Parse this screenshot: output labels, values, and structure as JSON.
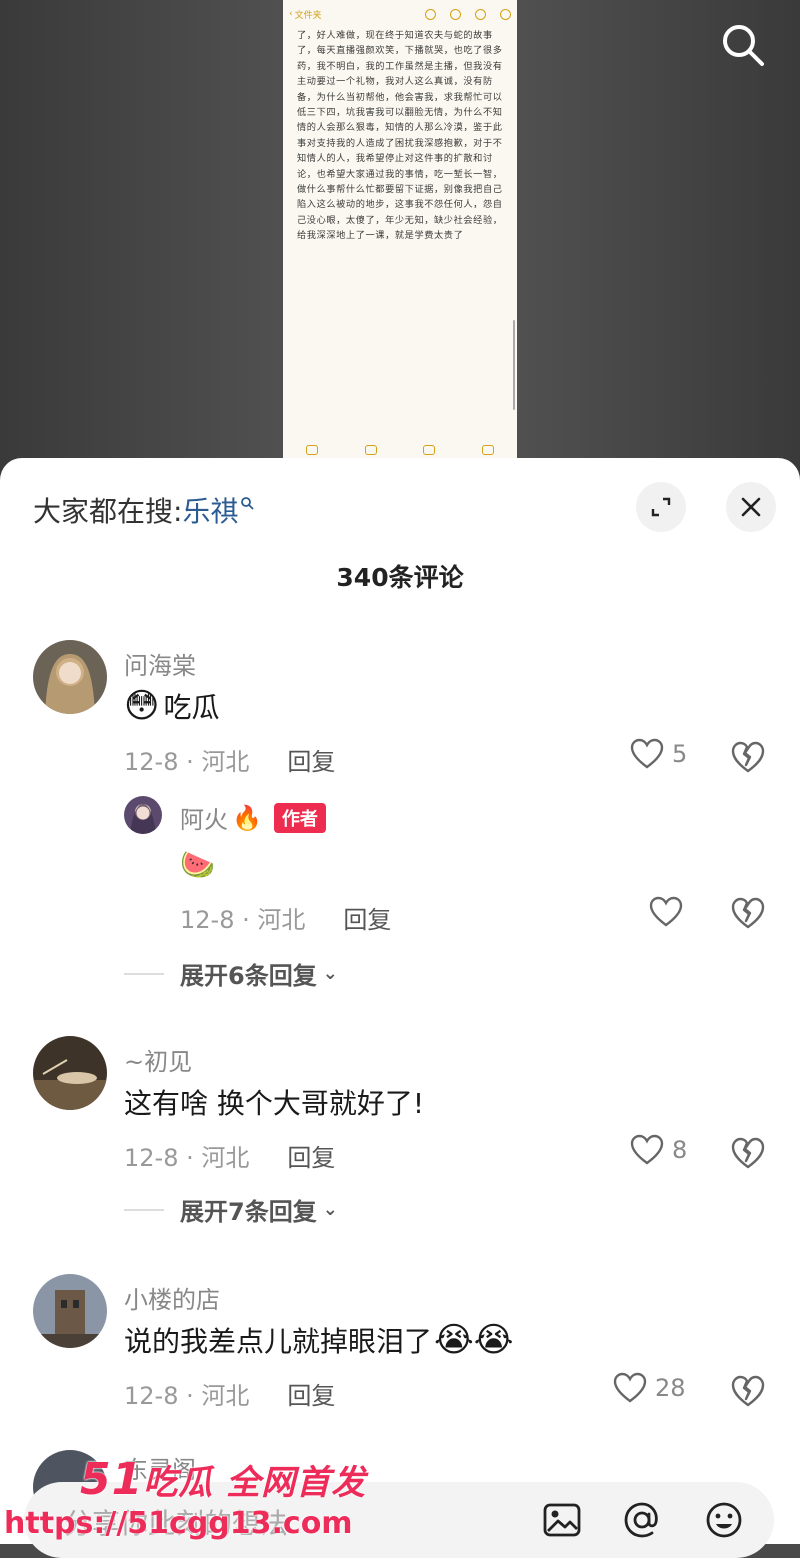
{
  "video": {
    "note_back_label": "文件夹",
    "note_text": "了，好人难做，现在终于知道农夫与蛇的故事了，每天直播强颜欢笑，下播就哭，也吃了很多药，我不明白，我的工作虽然是主播，但我没有主动要过一个礼物，我对人这么真诚，没有防备，为什么当初帮他，他会害我，求我帮忙可以低三下四，坑我害我可以翻脸无情，为什么不知情的人会那么狠毒，知情的人那么冷漠，鉴于此事对支持我的人造成了困扰我深感抱歉，对于不知情人的人，我希望停止对这件事的扩散和讨论，也希望大家通过我的事情，吃一堑长一智，做什么事帮什么忙都要留下证据，别像我把自己陷入这么被动的地步，这事我不怨任何人，怨自己没心眼，太傻了，年少无知，缺少社会经验，给我深深地上了一课，就是学费太贵了"
  },
  "sheet": {
    "trending_prefix": "大家都在搜:",
    "trending_term": "乐祺",
    "comment_count_label": "340条评论"
  },
  "comments": [
    {
      "username": "问海棠",
      "text": "吃瓜",
      "date_location": "12-8 · 河北",
      "reply_label": "回复",
      "likes": "5",
      "replies": [
        {
          "username": "阿火",
          "badge": "作者",
          "text": "🍉",
          "date_location": "12-8 · 河北",
          "reply_label": "回复"
        }
      ],
      "expand_label": "展开6条回复"
    },
    {
      "username": "~初见",
      "text": "这有啥 换个大哥就好了!",
      "date_location": "12-8 · 河北",
      "reply_label": "回复",
      "likes": "8",
      "expand_label": "展开7条回复"
    },
    {
      "username": "小楼的店",
      "text": "说的我差点儿就掉眼泪了",
      "date_location": "12-8 · 河北",
      "reply_label": "回复",
      "likes": "28"
    },
    {
      "username": "东灵阁"
    }
  ],
  "input": {
    "placeholder": "分享你此刻的想法"
  },
  "watermark": {
    "number": "51",
    "line1": "吃瓜 全网首发",
    "line2": "https://51cgg13.com"
  },
  "colors": {
    "accent_red": "#ee2c4f",
    "link_blue": "#2c5b92",
    "note_yellow": "#d4a017"
  }
}
